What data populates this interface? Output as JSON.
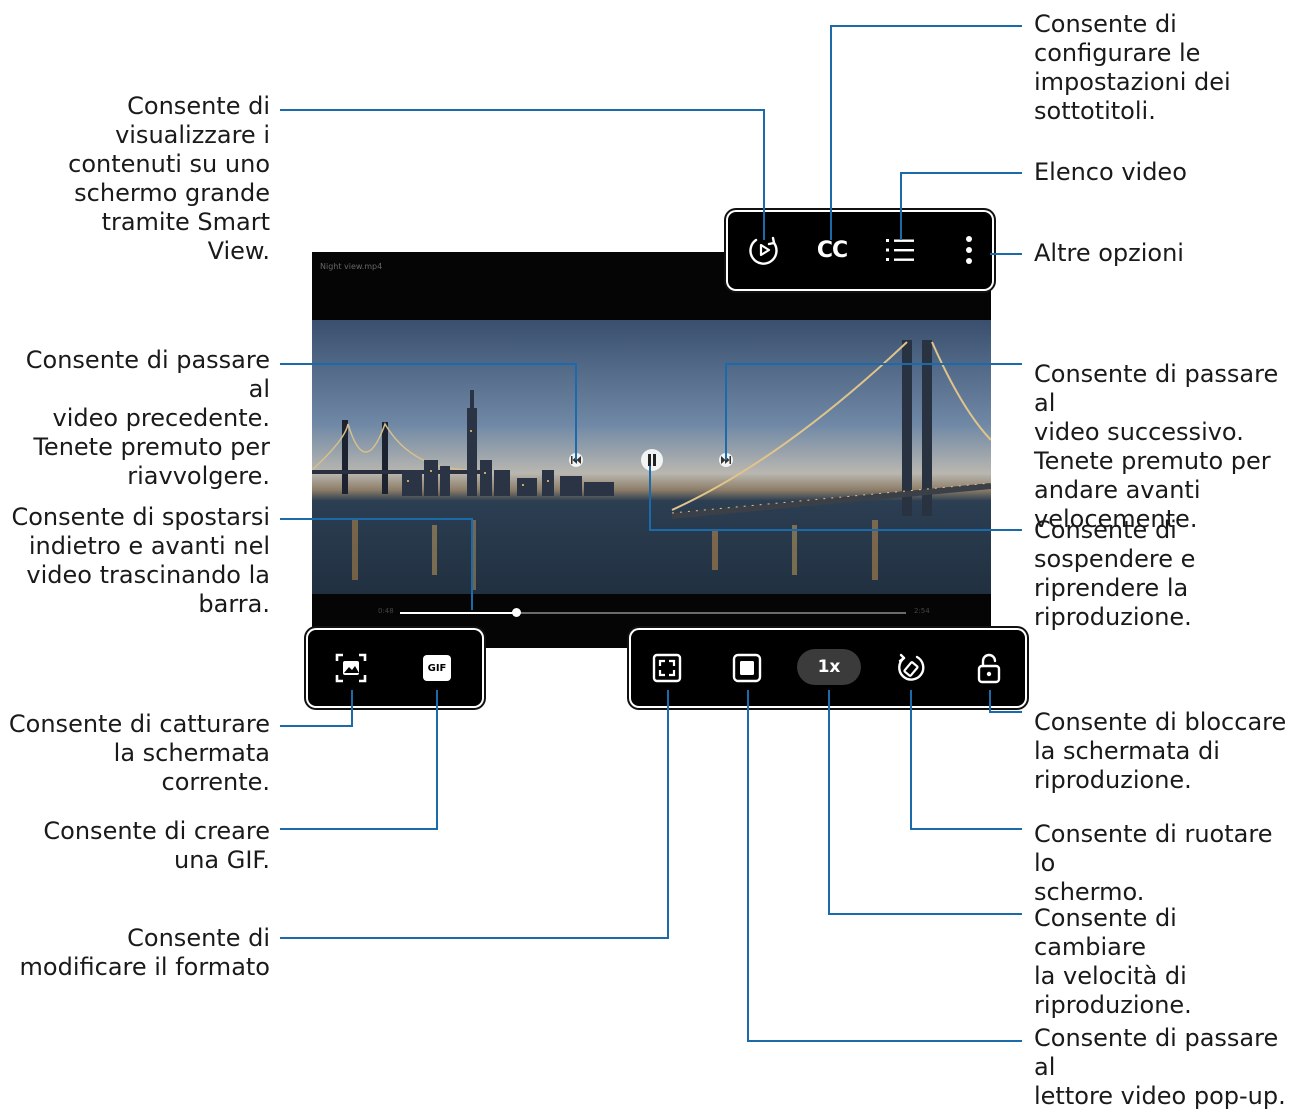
{
  "screen": {
    "title": "Night view.mp4",
    "time_current": "0:48",
    "time_total": "2:54",
    "progress": 0.23
  },
  "top_panel": {
    "cc_label": "CC"
  },
  "capture_panel": {
    "gif_label": "GIF"
  },
  "bottom_panel": {
    "speed_label": "1x"
  },
  "colors": {
    "callout_line": "#1b6aa9",
    "panel_bg": "#000000"
  },
  "callouts": {
    "smart_view": [
      "Consente di",
      "visualizzare i",
      "contenuti su uno",
      "schermo grande",
      "tramite Smart View."
    ],
    "subtitles": [
      "Consente di",
      "configurare le",
      "impostazioni dei",
      "sottotitoli."
    ],
    "video_list": [
      "Elenco video"
    ],
    "more_options": [
      "Altre opzioni"
    ],
    "prev_video": [
      "Consente di passare al",
      "video precedente.",
      "Tenete premuto per",
      "riavvolgere."
    ],
    "next_video": [
      "Consente di passare al",
      "video successivo.",
      "Tenete premuto per",
      "andare avanti",
      "velocemente."
    ],
    "seek": [
      "Consente di spostarsi",
      "indietro e avanti nel",
      "video trascinando la",
      "barra."
    ],
    "pause": [
      "Consente di",
      "sospendere e",
      "riprendere la",
      "riproduzione."
    ],
    "capture": [
      "Consente di catturare",
      "la schermata",
      "corrente."
    ],
    "gif": [
      "Consente di creare",
      "una GIF."
    ],
    "lock": [
      "Consente di bloccare",
      "la schermata di",
      "riproduzione."
    ],
    "rotate": [
      "Consente di ruotare lo",
      "schermo."
    ],
    "ratio": [
      "Consente di",
      "modificare il formato"
    ],
    "speed": [
      "Consente di cambiare",
      "la velocità di",
      "riproduzione."
    ],
    "popup": [
      "Consente di passare al",
      "lettore video pop-up."
    ]
  }
}
